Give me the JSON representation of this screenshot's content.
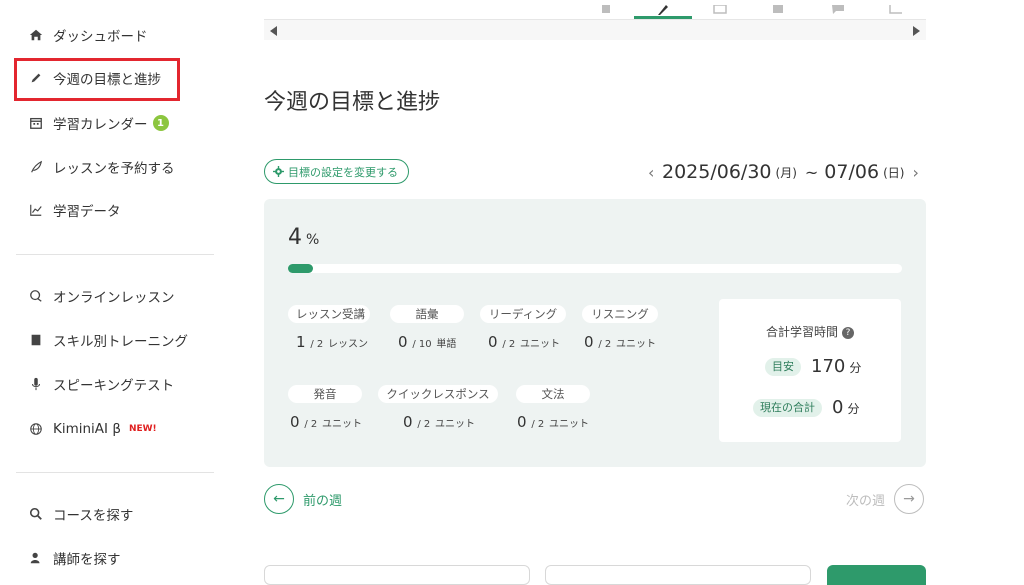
{
  "sidebar": {
    "items": [
      {
        "label": "ダッシュボード",
        "icon": "home-icon"
      },
      {
        "label": "今週の目標と進捗",
        "icon": "pencil-icon"
      },
      {
        "label": "学習カレンダー",
        "icon": "calendar-icon",
        "badge": "1"
      },
      {
        "label": "レッスンを予約する",
        "icon": "feather-icon"
      },
      {
        "label": "学習データ",
        "icon": "line-chart-icon"
      },
      {
        "label": "オンラインレッスン",
        "icon": "chat-bubbles-icon"
      },
      {
        "label": "スキル別トレーニング",
        "icon": "book-icon"
      },
      {
        "label": "スピーキングテスト",
        "icon": "microphone-icon"
      },
      {
        "label": "KiminiAI β",
        "icon": "globe-icon",
        "tag": "NEW!"
      },
      {
        "label": "コースを探す",
        "icon": "search-icon"
      },
      {
        "label": "講師を探す",
        "icon": "teacher-icon"
      }
    ]
  },
  "colors": {
    "accent": "#2e9a6b",
    "highlight": "#e3262f",
    "badge": "#8cc63f",
    "panel": "#eef3f2"
  },
  "main": {
    "title": "今週の目標と進捗",
    "goal_button": "目標の設定を変更する",
    "date_range": {
      "start": "2025/06/30",
      "start_dow": "(月)",
      "separator": "~",
      "end": "07/06",
      "end_dow": "(日)"
    },
    "progress": {
      "value": "4",
      "unit": "%",
      "fraction": 0.04
    },
    "categories": [
      {
        "label": "レッスン受講",
        "done": "1",
        "total": "/ 2",
        "unit": "レッスン"
      },
      {
        "label": "語彙",
        "done": "0",
        "total": "/ 10",
        "unit": "単語"
      },
      {
        "label": "リーディング",
        "done": "0",
        "total": "/ 2",
        "unit": "ユニット"
      },
      {
        "label": "リスニング",
        "done": "0",
        "total": "/ 2",
        "unit": "ユニット"
      },
      {
        "label": "発音",
        "done": "0",
        "total": "/ 2",
        "unit": "ユニット"
      },
      {
        "label": "クイックレスポンス",
        "done": "0",
        "total": "/ 2",
        "unit": "ユニット"
      },
      {
        "label": "文法",
        "done": "0",
        "total": "/ 2",
        "unit": "ユニット"
      }
    ],
    "total_time": {
      "title": "合計学習時間",
      "target_label": "目安",
      "target_value": "170",
      "target_unit": "分",
      "current_label": "現在の合計",
      "current_value": "0",
      "current_unit": "分"
    },
    "prev_week": "前の週",
    "next_week": "次の週"
  }
}
